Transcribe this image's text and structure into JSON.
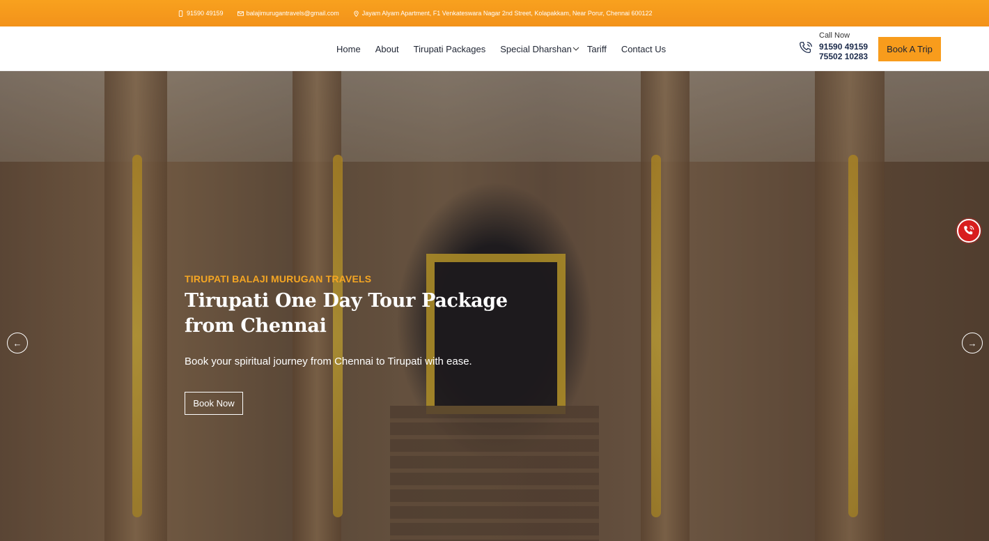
{
  "topbar": {
    "phone": "91590 49159",
    "email": "balajimurugantravels@gmail.com",
    "address": "Jayam Alyam Apartment, F1 Venkateswara Nagar 2nd Street, Kolapakkam, Near Porur, Chennai 600122"
  },
  "nav": {
    "items": [
      {
        "label": "Home"
      },
      {
        "label": "About"
      },
      {
        "label": "Tirupati Packages"
      },
      {
        "label": "Special Dharshan"
      },
      {
        "label": "Tariff"
      },
      {
        "label": "Contact Us"
      }
    ]
  },
  "call": {
    "label": "Call Now",
    "number1": "91590 49159",
    "number2": "75502 10283"
  },
  "cta": {
    "book_trip": "Book A Trip"
  },
  "hero": {
    "kicker": "TIRUPATI BALAJI MURUGAN TRAVELS",
    "title_line1": "Tirupati One Day Tour Package",
    "title_line2": "from Chennai",
    "subtitle": "Book your spiritual journey from Chennai to Tirupati with ease.",
    "button": "Book Now",
    "prev_icon": "←",
    "next_icon": "→"
  },
  "colors": {
    "accent": "#f89c1c",
    "kicker": "#f5a623",
    "float_call": "#d81e1e"
  },
  "icons": [
    "phone-icon",
    "mail-icon",
    "location-icon",
    "chevron-down-icon",
    "call-icon",
    "arrow-left-icon",
    "arrow-right-icon",
    "floating-call-icon"
  ]
}
